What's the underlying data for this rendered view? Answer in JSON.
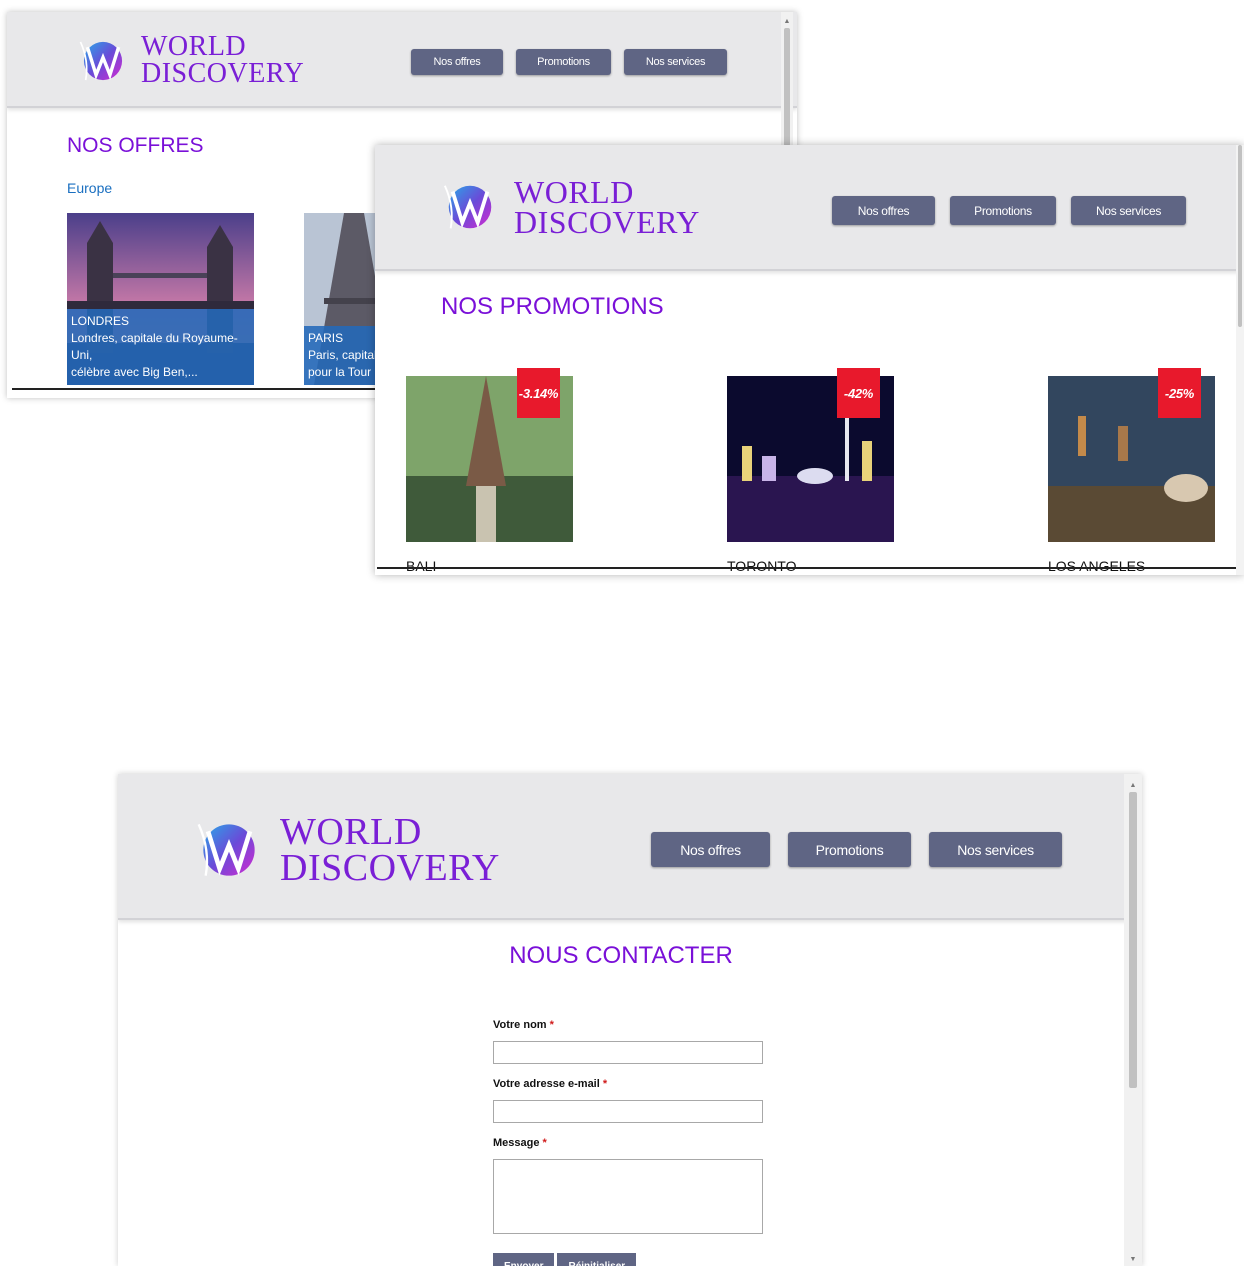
{
  "site": {
    "logo_line1": "WORLD",
    "logo_line2": "DISCOVERY",
    "nav": [
      "Nos offres",
      "Promotions",
      "Nos services"
    ],
    "brand_color": "#7a10d8",
    "nav_color": "#5f6584"
  },
  "offres": {
    "title": "NOS OFFRES",
    "region": "Europe",
    "cards": [
      {
        "city": "LONDRES",
        "desc_line1": "Londres, capitale du Royaume-Uni,",
        "desc_line2": "célèbre avec Big Ben,..."
      },
      {
        "city": "PARIS",
        "desc_line1": "Paris, capitale",
        "desc_line2": "pour la Tour E"
      }
    ]
  },
  "promotions": {
    "title": "NOS PROMOTIONS",
    "items": [
      {
        "name": "BALI",
        "discount": "-3.14%"
      },
      {
        "name": "TORONTO",
        "discount": "-42%"
      },
      {
        "name": "LOS ANGELES",
        "discount": "-25%"
      }
    ],
    "badge_color": "#e8192c"
  },
  "contact": {
    "title": "NOUS CONTACTER",
    "name_label": "Votre nom",
    "email_label": "Votre adresse e-mail",
    "message_label": "Message",
    "required_mark": "*",
    "submit_label": "Envoyer",
    "reset_label": "Réinitialiser"
  }
}
